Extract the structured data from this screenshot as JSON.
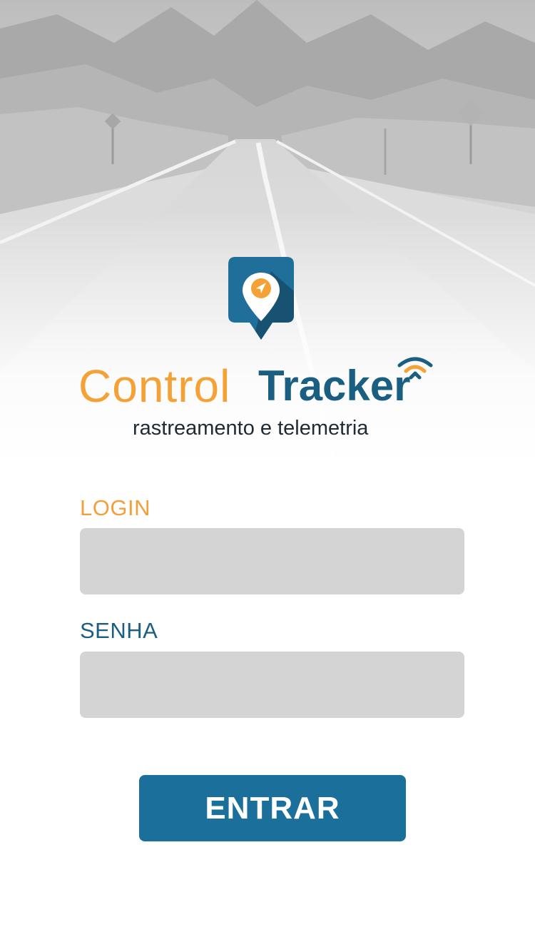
{
  "brand": {
    "name_part1": "Control",
    "name_part2": "Tracker",
    "tagline": "rastreamento e telemetria"
  },
  "form": {
    "login_label": "LOGIN",
    "login_value": "",
    "senha_label": "SENHA",
    "senha_value": ""
  },
  "actions": {
    "submit_label": "ENTRAR"
  },
  "icons": {
    "logo": "location-pin-navigation-icon",
    "wifi": "wifi-signal-icon",
    "background": "road-landscape-photo"
  },
  "colors": {
    "accent_orange": "#f4a236",
    "brand_blue": "#1a5f82",
    "button_blue": "#1b6f9b",
    "input_gray": "#d4d4d4"
  }
}
